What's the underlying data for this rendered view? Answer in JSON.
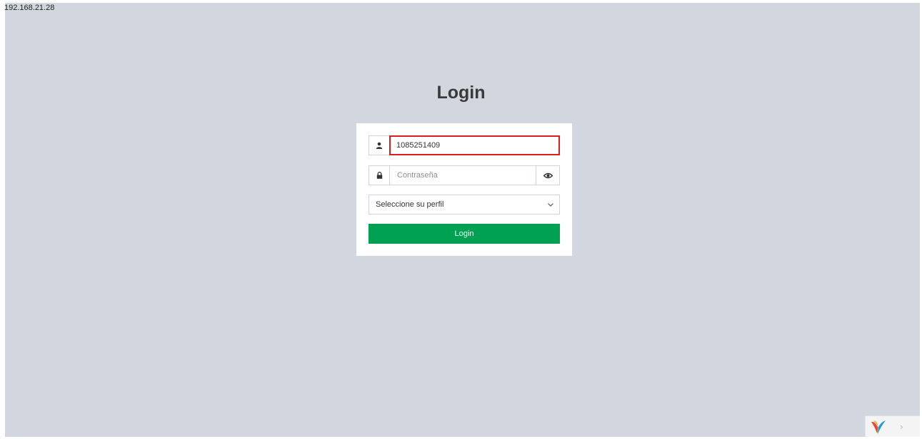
{
  "address_bar": {
    "ip": "192.168.21.28"
  },
  "page": {
    "title": "Login"
  },
  "form": {
    "username": {
      "value": "1085251409",
      "icon": "user-icon"
    },
    "password": {
      "placeholder": "Contraseña",
      "icon": "lock-icon",
      "toggle_icon": "eye-icon"
    },
    "profile_select": {
      "selected": "Seleccione su perfil",
      "icon": "chevron-down-icon"
    },
    "submit_label": "Login"
  },
  "debug_toolbar": {
    "logo": "yii-logo",
    "toggle_icon": "chevron-right-icon"
  },
  "colors": {
    "background": "#d1d6df",
    "card": "#ffffff",
    "button": "#00a150",
    "highlight_border": "#e01b1b"
  }
}
